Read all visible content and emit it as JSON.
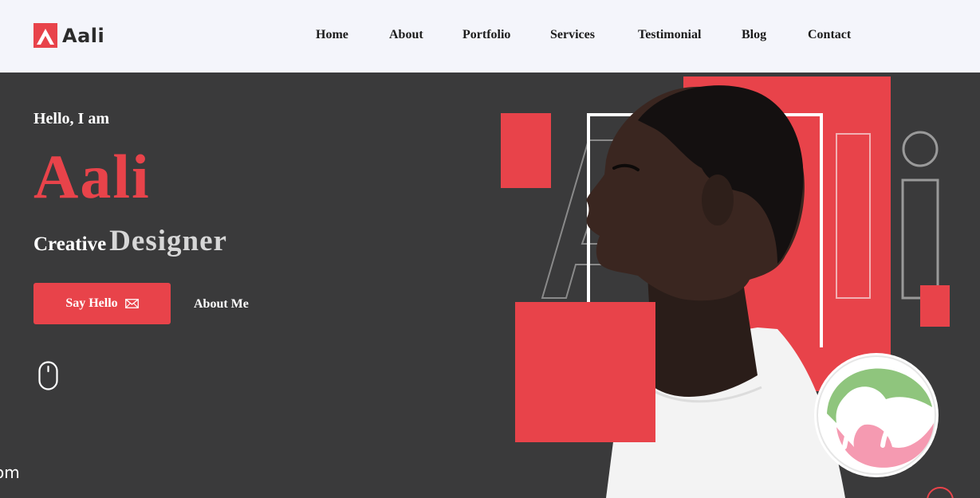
{
  "brand": {
    "name": "Aali",
    "accent_color": "#e8434a"
  },
  "nav": {
    "items": [
      "Home",
      "About",
      "Portfolio",
      "Services",
      "Testimonial",
      "Blog",
      "Contact"
    ]
  },
  "hero": {
    "greeting": "Hello, I am",
    "name": "Aali",
    "role_prefix": "Creative",
    "role_main": "Designer",
    "primary_button": "Say Hello",
    "primary_button_icon": "envelope-icon",
    "secondary_link": "About Me",
    "scroll_icon": "mouse-scroll-icon",
    "side_text": "om",
    "background_letters": "Aali"
  }
}
